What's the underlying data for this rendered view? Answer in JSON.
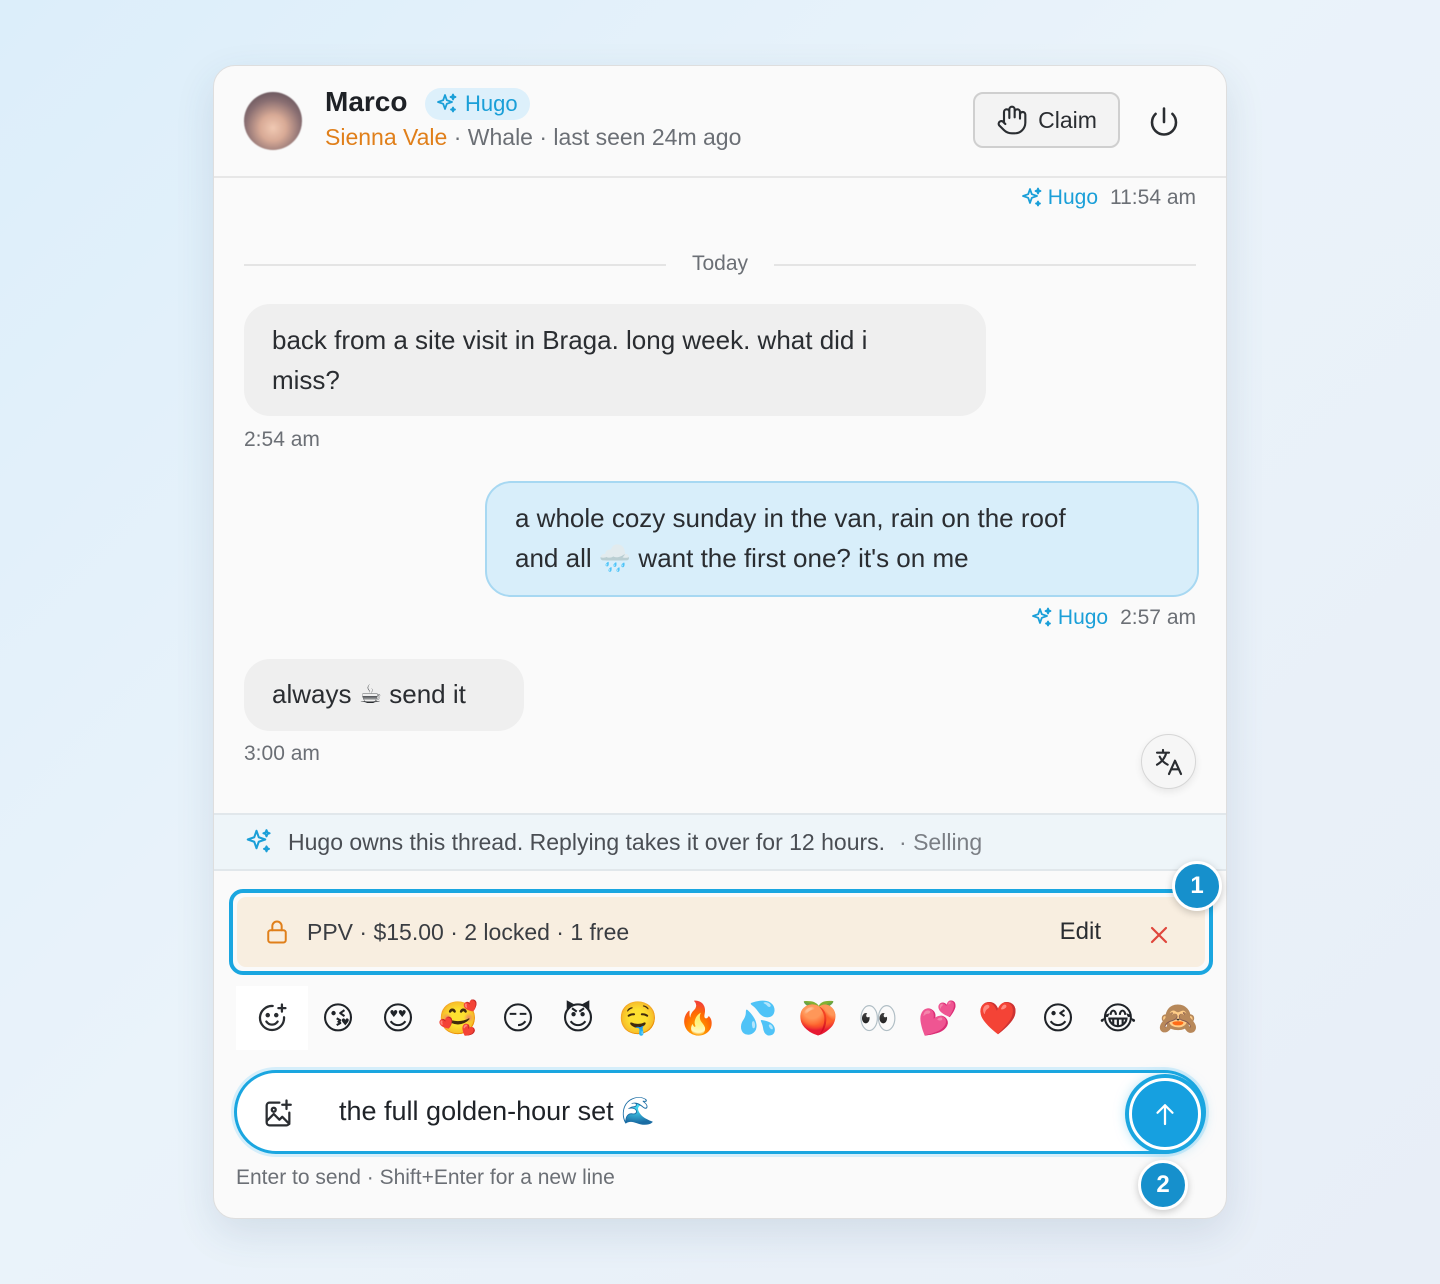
{
  "header": {
    "name": "Marco",
    "badge": "Hugo",
    "persona": "Sienna Vale",
    "meta": " · Whale · last seen 24m ago",
    "claim_label": "Claim"
  },
  "thread": {
    "top_stamp": {
      "author": "Hugo",
      "time": "11:54 am"
    },
    "day_divider": "Today",
    "messages": [
      {
        "direction": "incoming",
        "text_line1": "back from a site visit in Braga. long week. what did i",
        "text_line2": "miss?",
        "time": "2:54 am"
      },
      {
        "direction": "outgoing",
        "text_line1": "a whole cozy sunday in the van, rain on the roof",
        "text_line2": "and all 🌧️ want the first one? it's on me",
        "author": "Hugo",
        "time": "2:57 am"
      },
      {
        "direction": "incoming",
        "text_line1": "always ☕ send it",
        "time": "3:00 am"
      }
    ]
  },
  "ownership_bar": {
    "text": "Hugo owns this thread. Replying takes it over for 12 hours.",
    "mode": "· Selling"
  },
  "ppv": {
    "summary": "PPV · $15.00 · 2 locked · 1 free",
    "edit_label": "Edit"
  },
  "callouts": [
    "1",
    "2"
  ],
  "emoji_bar": [
    "😘",
    "😍",
    "🥰",
    "😏",
    "😈",
    "🤤",
    "🔥",
    "💦",
    "🍑",
    "👀",
    "💕",
    "❤️",
    "😉",
    "😂",
    "🙈"
  ],
  "composer": {
    "value": "the full golden-hour set 🌊",
    "hint": "Enter to send · Shift+Enter for a new line"
  },
  "colors": {
    "accent": "#1aa6e0",
    "persona": "#e07f1a",
    "ppv_bg": "#f8eee0",
    "outgoing_bubble": "#d8eefa"
  },
  "icons": [
    "sparkle-icon",
    "hand-icon",
    "power-icon",
    "translate-icon",
    "lock-icon",
    "close-icon",
    "emoji-add-icon",
    "image-add-icon",
    "arrow-up-icon"
  ]
}
